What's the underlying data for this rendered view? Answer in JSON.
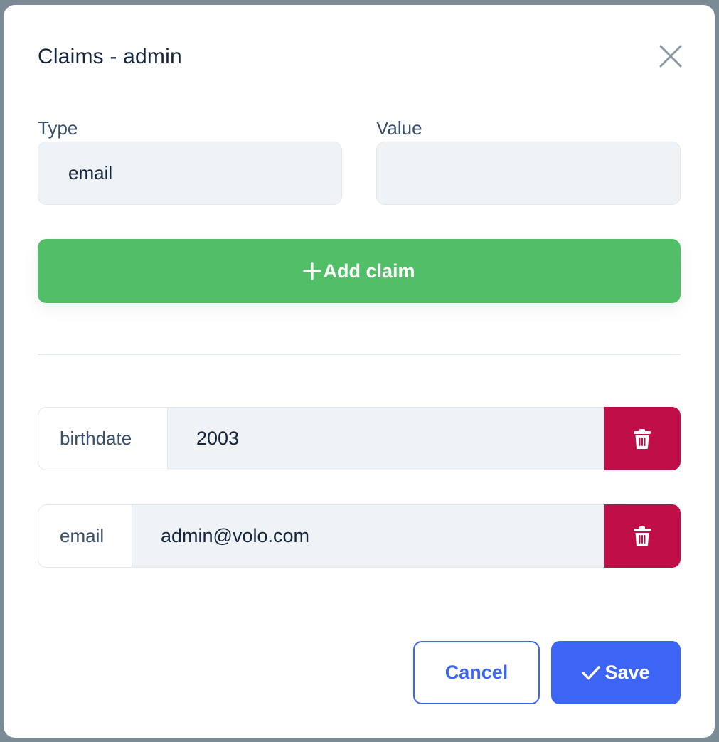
{
  "modal": {
    "title": "Claims - admin"
  },
  "form": {
    "type_label": "Type",
    "type_value": "email",
    "value_label": "Value",
    "value_value": "",
    "add_button_label": "Add claim"
  },
  "claims": [
    {
      "type": "birthdate",
      "value": "2003"
    },
    {
      "type": "email",
      "value": "admin@volo.com"
    }
  ],
  "footer": {
    "cancel_label": "Cancel",
    "save_label": "Save"
  },
  "colors": {
    "primary": "#3c64f5",
    "success": "#51bf67",
    "danger": "#c00f48"
  },
  "icons": {
    "close": "close-icon",
    "add": "plus-icon",
    "delete": "trash-icon",
    "save": "check-icon"
  }
}
